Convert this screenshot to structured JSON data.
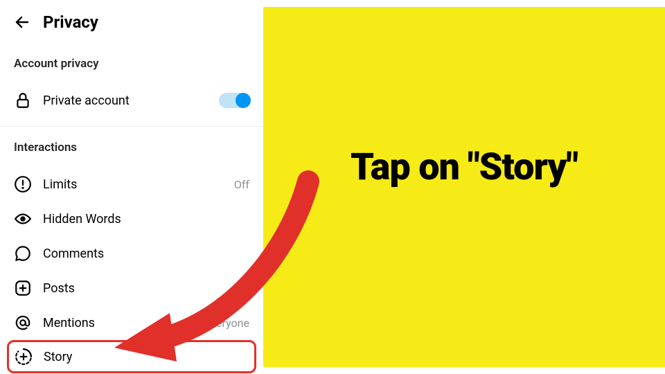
{
  "header": {
    "title": "Privacy"
  },
  "accountPrivacy": {
    "section_label": "Account privacy",
    "private_label": "Private account",
    "toggle_on": true
  },
  "interactions": {
    "section_label": "Interactions",
    "items": [
      {
        "label": "Limits",
        "value": "Off"
      },
      {
        "label": "Hidden Words",
        "value": ""
      },
      {
        "label": "Comments",
        "value": ""
      },
      {
        "label": "Posts",
        "value": ""
      },
      {
        "label": "Mentions",
        "value": "Everyone"
      },
      {
        "label": "Story",
        "value": ""
      }
    ]
  },
  "instruction": {
    "text": "Tap on \"Story\""
  },
  "colors": {
    "highlight": "#e1302a",
    "yellow": "#f6eb16",
    "toggle": "#0095f6"
  }
}
